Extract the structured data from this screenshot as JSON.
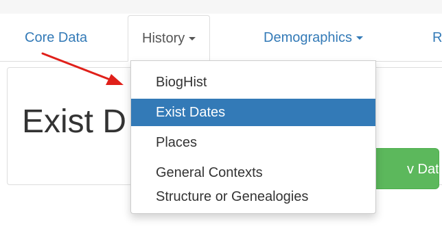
{
  "nav": {
    "tabs": [
      {
        "label": "Core Data"
      },
      {
        "label": "History",
        "open": true
      },
      {
        "label": "Demographics"
      },
      {
        "label": "R"
      }
    ]
  },
  "page": {
    "title": "Exist D",
    "green_button_label": "v Date"
  },
  "dropdown": {
    "items": [
      {
        "label": "BiogHist"
      },
      {
        "label": "Exist Dates",
        "active": true
      },
      {
        "label": "Places"
      },
      {
        "label": "General Contexts"
      },
      {
        "label": "Structure or Genealogies"
      }
    ]
  },
  "colors": {
    "link": "#337ab7",
    "active_item_bg": "#337ab7",
    "success": "#5cb85c",
    "arrow": "#e0201a"
  }
}
